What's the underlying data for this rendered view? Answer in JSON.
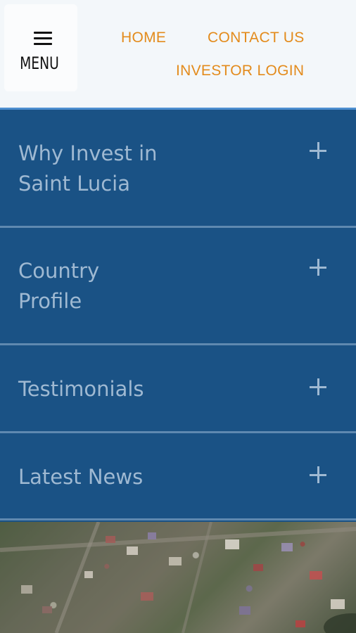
{
  "header": {
    "menu_label": "MENU",
    "nav": {
      "home": "HOME",
      "contact": "CONTACT US",
      "investor_login": "INVESTOR LOGIN"
    }
  },
  "accordion": {
    "items": [
      {
        "title_line1": "Why Invest in",
        "title_line2": "Saint Lucia",
        "icon": "plus-icon"
      },
      {
        "title_line1": "Country",
        "title_line2": "Profile",
        "icon": "plus-icon"
      },
      {
        "title_line1": "Testimonials",
        "icon": "plus-icon"
      },
      {
        "title_line1": "Latest News",
        "icon": "plus-icon"
      }
    ]
  },
  "colors": {
    "header_bg": "#f3f7fa",
    "nav_link": "#e38b1c",
    "accordion_bg": "#1a5285",
    "accordion_text": "#9fb9d2",
    "divider": "#5f89b0"
  }
}
